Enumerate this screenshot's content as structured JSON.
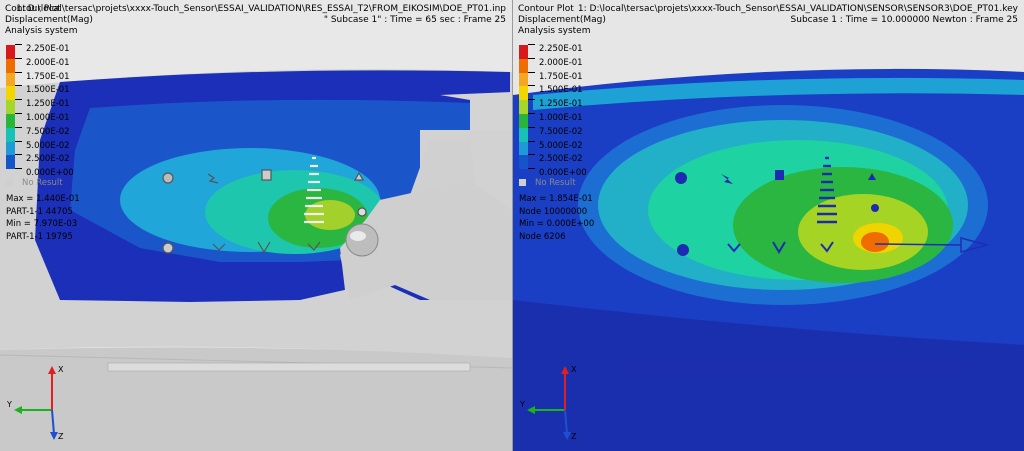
{
  "left_view": {
    "header": {
      "line1": "Contour Plot",
      "path": "1: D:\\local\\tersac\\projets\\xxxx-Touch_Sensor\\ESSAI_VALIDATION\\RES_ESSAI_T2\\FROM_EIKOSIM\\DOE_PT01.inp",
      "line2": "Displacement(Mag)",
      "subcase": "\" Subcase 1\"  : Time = 65 sec  : Frame 25",
      "line3": "Analysis system"
    },
    "legend": [
      "2.250E-01",
      "2.000E-01",
      "1.750E-01",
      "1.500E-01",
      "1.250E-01",
      "1.000E-01",
      "7.500E-02",
      "5.000E-02",
      "2.500E-02",
      "0.000E+00"
    ],
    "no_result": "No Result",
    "stats": [
      "Max = 1.440E-01",
      "PART-1-1 44705",
      "Min = 7.970E-03",
      "PART-1-1 19795"
    ]
  },
  "right_view": {
    "header": {
      "line1": "Contour Plot",
      "path": "1: D:\\local\\tersac\\projets\\xxxx-Touch_Sensor\\ESSAI_VALIDATION\\SENSOR\\SENSOR3\\DOE_PT01.key",
      "line2": "Displacement(Mag)",
      "subcase": "Subcase 1  : Time = 10.000000 Newton  : Frame 25",
      "line3": "Analysis system"
    },
    "legend": [
      "2.250E-01",
      "2.000E-01",
      "1.750E-01",
      "1.500E-01",
      "1.250E-01",
      "1.000E-01",
      "7.500E-02",
      "5.000E-02",
      "2.500E-02",
      "0.000E+00"
    ],
    "no_result": "No Result",
    "stats": [
      "Max = 1.854E-01",
      "Node 10000000",
      "Min = 0.000E+00",
      "Node 6206"
    ]
  },
  "legend_colors": [
    "#d7191c",
    "#ef6c00",
    "#f5a623",
    "#f2d600",
    "#a7d62a",
    "#27b53c",
    "#17c1b5",
    "#1e9ad6",
    "#1655c9",
    "#1020a0"
  ],
  "triad": {
    "x": "X",
    "y": "Y",
    "z": "Z"
  }
}
